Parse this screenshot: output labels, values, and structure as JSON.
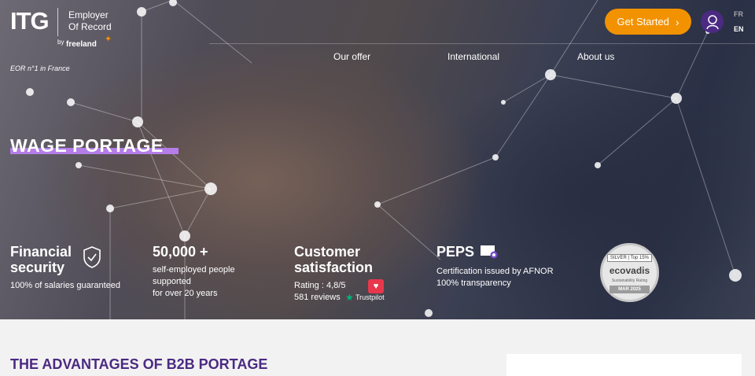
{
  "logo": {
    "brand": "ITG",
    "subtitle_line1": "Employer",
    "subtitle_line2": "Of Record",
    "by": "by",
    "partner": "freeland"
  },
  "tagline": "EOR n°1 in France",
  "header": {
    "cta_label": "Get Started",
    "lang_fr": "FR",
    "lang_en": "EN"
  },
  "nav": {
    "items": [
      "Our offer",
      "International",
      "About us"
    ]
  },
  "hero": {
    "title": "WAGE PORTAGE"
  },
  "stats": [
    {
      "title_line1": "Financial",
      "title_line2": "security",
      "text_line1": "100% of salaries guaranteed"
    },
    {
      "title_line1": "50,000 +",
      "text_line1": "self-employed people",
      "text_line2": "supported",
      "text_line3": "for over 20 years"
    },
    {
      "title_line1": "Customer",
      "title_line2": "satisfaction",
      "text_line1": "Rating : 4,8/5",
      "text_line2": "581 reviews",
      "trust_label": "Trustpilot"
    },
    {
      "title_line1": "PEPS",
      "text_line1": "Certification issued by AFNOR",
      "text_line2": "100% transparency"
    }
  ],
  "ecovadis": {
    "rank": "SILVER | Top 15%",
    "name": "ecovadis",
    "rating_label": "Sustainability Rating",
    "date": "MAR 2025"
  },
  "section": {
    "title": "THE ADVANTAGES OF B2B PORTAGE"
  },
  "colors": {
    "accent": "#f39200",
    "brand_purple": "#4a2a82",
    "highlight": "#b57de8"
  }
}
